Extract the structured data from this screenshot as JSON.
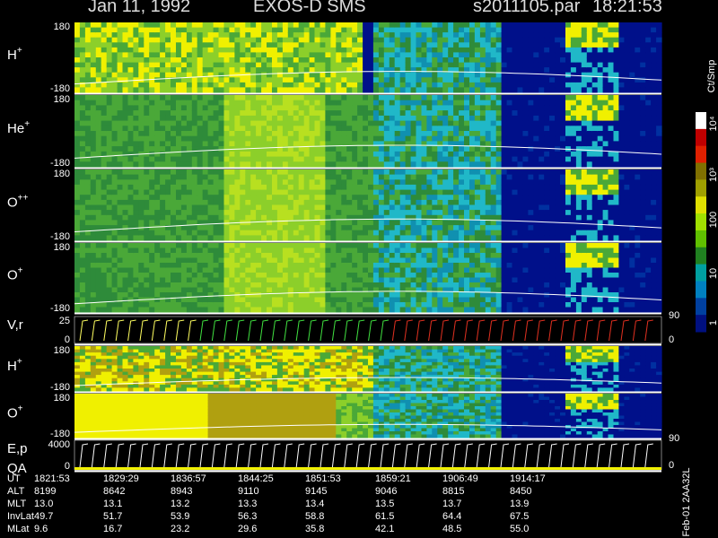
{
  "header": {
    "date": "Jan 11, 1992",
    "instrument": "EXOS-D SMS",
    "file": "s2011105.par",
    "time": "18:21:53"
  },
  "colorbar": {
    "unit": "Ct/Smp",
    "ticks": [
      "10⁴",
      "10³",
      "100",
      "10",
      "1"
    ],
    "colors": [
      "#ffffff",
      "#c00000",
      "#e02000",
      "#807000",
      "#a0a000",
      "#e0e000",
      "#a0e000",
      "#60c000",
      "#208020",
      "#00a0a0",
      "#0080c0",
      "#0040a0",
      "#001080"
    ]
  },
  "panels": [
    {
      "id": "h-plus-1",
      "label": "H",
      "sup": "+",
      "top": "180",
      "bottom": "-180"
    },
    {
      "id": "he-plus",
      "label": "He",
      "sup": "+",
      "top": "180",
      "bottom": "-180"
    },
    {
      "id": "o-plus-plus",
      "label": "O",
      "sup": "++",
      "top": "180",
      "bottom": "-180"
    },
    {
      "id": "o-plus-1",
      "label": "O",
      "sup": "+",
      "top": "180",
      "bottom": "-180"
    },
    {
      "id": "vr",
      "label": "V,r",
      "sup": "",
      "top": "25",
      "bottom": "0"
    },
    {
      "id": "h-plus-2",
      "label": "H",
      "sup": "+",
      "top": "180",
      "bottom": "-180"
    },
    {
      "id": "o-plus-2",
      "label": "O",
      "sup": "+",
      "top": "180",
      "bottom": "-180"
    },
    {
      "id": "ep-qa",
      "label": "E,p",
      "sup": "",
      "top": "4000",
      "bottom": "0",
      "extra": "QA"
    }
  ],
  "right_axis": {
    "vr_top": "90",
    "vr_bottom": "0",
    "ep_top": "90",
    "ep_bottom": "0"
  },
  "side_note": "Feb-01 2AA32L",
  "table": {
    "rows": [
      {
        "name": "UT",
        "values": [
          "1821:53",
          "1829:29",
          "1836:57",
          "1844:25",
          "1851:53",
          "1859:21",
          "1906:49",
          "1914:17"
        ]
      },
      {
        "name": "ALT",
        "values": [
          "8199",
          "8642",
          "8943",
          "9110",
          "9145",
          "9046",
          "8815",
          "8450"
        ]
      },
      {
        "name": "MLT",
        "values": [
          "13.0",
          "13.1",
          "13.2",
          "13.3",
          "13.4",
          "13.5",
          "13.7",
          "13.9"
        ]
      },
      {
        "name": "InvLat",
        "values": [
          "49.7",
          "51.7",
          "53.9",
          "56.3",
          "58.8",
          "61.5",
          "64.4",
          "67.5"
        ]
      },
      {
        "name": "MLat",
        "values": [
          "9.6",
          "16.7",
          "23.2",
          "29.6",
          "35.8",
          "42.1",
          "48.5",
          "55.0"
        ]
      }
    ]
  },
  "chart_data": {
    "type": "heatmap",
    "x": [
      "1821:53",
      "1829:29",
      "1836:57",
      "1844:25",
      "1851:53",
      "1859:21",
      "1906:49",
      "1914:17"
    ],
    "y_range": [
      -180,
      180
    ],
    "color_scale": "log",
    "color_unit": "Ct/Smp",
    "color_range": [
      1,
      10000
    ],
    "series": [
      {
        "name": "H+",
        "ylim": [
          -180,
          180
        ]
      },
      {
        "name": "He+",
        "ylim": [
          -180,
          180
        ]
      },
      {
        "name": "O++",
        "ylim": [
          -180,
          180
        ]
      },
      {
        "name": "O+",
        "ylim": [
          -180,
          180
        ]
      },
      {
        "name": "V,r",
        "ylim": [
          0,
          25
        ]
      },
      {
        "name": "H+",
        "ylim": [
          -180,
          180
        ]
      },
      {
        "name": "O+",
        "ylim": [
          -180,
          180
        ]
      },
      {
        "name": "E,p",
        "ylim": [
          0,
          4000
        ]
      }
    ]
  }
}
